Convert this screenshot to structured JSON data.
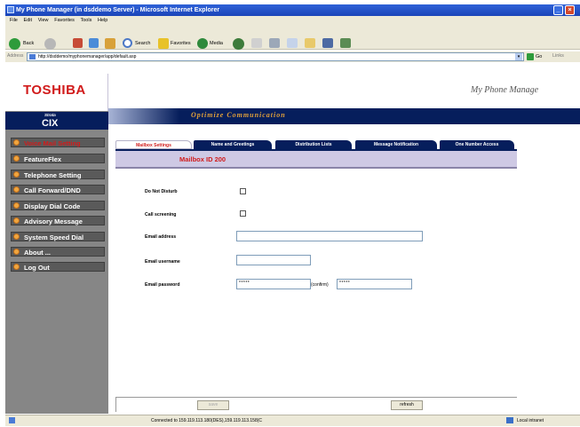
{
  "window": {
    "title": "My Phone Manager (in dsddemo Server) - Microsoft Internet Explorer"
  },
  "menubar": {
    "items": [
      "File",
      "Edit",
      "View",
      "Favorites",
      "Tools",
      "Help"
    ]
  },
  "toolbar": {
    "back_label": "Back",
    "search_label": "Search",
    "favorites_label": "Favorites",
    "media_label": "Media"
  },
  "addressbar": {
    "label": "Address",
    "url": "http://dsddemo/myphonemanager/app/default.asp",
    "go_label": "Go",
    "links_label": "Links"
  },
  "header": {
    "brand": "TOSHIBA",
    "app_title": "My Phone Manage",
    "logo_top": "Strata",
    "logo_main": "CIX",
    "tagline": "Optimize Communication"
  },
  "sidebar": {
    "items": [
      {
        "label": "Voice Mail Setting"
      },
      {
        "label": "FeatureFlex"
      },
      {
        "label": "Telephone Setting"
      },
      {
        "label": "Call Forward/DND"
      },
      {
        "label": "Display Dial Code"
      },
      {
        "label": "Advisory Message"
      },
      {
        "label": "System Speed Dial"
      },
      {
        "label": "About ..."
      },
      {
        "label": "Log Out"
      }
    ]
  },
  "tabs": [
    {
      "label": "Mailbox Settings"
    },
    {
      "label": "Name and Greetings"
    },
    {
      "label": "Distribution Lists"
    },
    {
      "label": "Message Notification"
    },
    {
      "label": "One Number Access"
    }
  ],
  "mailbox": {
    "id_label": "Mailbox ID 200"
  },
  "form": {
    "do_not_disturb_label": "Do Not Disturb",
    "call_screening_label": "Call screening",
    "email_address_label": "Email address",
    "email_address_value": "",
    "email_username_label": "Email username",
    "email_username_value": "",
    "email_password_label": "Email password",
    "email_password_value": "*****",
    "confirm_label": "(confirm)",
    "confirm_value": "*****"
  },
  "buttons": {
    "save_label": "save",
    "refresh_label": "refresh"
  },
  "status": {
    "text": "Connected to 159.119.113.180(DES),159.119.113.158(C",
    "zone": "Local intranet"
  }
}
